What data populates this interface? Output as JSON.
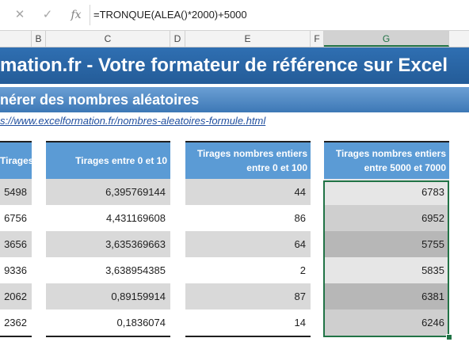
{
  "formula_bar": {
    "cancel_icon": "x-icon",
    "enter_icon": "check-icon",
    "fx_label": "fx",
    "formula": "=TRONQUE(ALEA()*2000)+5000"
  },
  "columns": [
    {
      "label": "B",
      "selected": false
    },
    {
      "label": "C",
      "selected": false
    },
    {
      "label": "D",
      "selected": false
    },
    {
      "label": "E",
      "selected": false
    },
    {
      "label": "F",
      "selected": false
    },
    {
      "label": "G",
      "selected": true
    }
  ],
  "title": "mation.fr - Votre formateur de référence sur Excel",
  "subtitle": "nérer des nombres aléatoires",
  "link": "s://www.excelformation.fr/nombres-aleatoires-formule.html",
  "table": {
    "col_a": {
      "header": [
        "Tirages"
      ],
      "values": [
        "5498",
        "6756",
        "3656",
        "9336",
        "2062",
        "2362"
      ]
    },
    "col_c": {
      "header": [
        "Tirages entre 0 et 10"
      ],
      "values": [
        "6,395769144",
        "4,431169608",
        "3,635369663",
        "3,638954385",
        "0,89159914",
        "0,1836074"
      ]
    },
    "col_e": {
      "header": [
        "Tirages nombres entiers",
        "entre 0 et 100"
      ],
      "values": [
        "44",
        "86",
        "64",
        "2",
        "87",
        "14"
      ]
    },
    "col_g": {
      "header": [
        "Tirages nombres entiers",
        "entre 5000 et 7000"
      ],
      "values": [
        "6783",
        "6952",
        "5755",
        "5835",
        "6381",
        "6246"
      ]
    }
  },
  "colors": {
    "accent": "#217346",
    "header_blue": "#5b9bd5",
    "title_blue": "#2f6fb2",
    "row_gray": "#d9d9d9"
  }
}
